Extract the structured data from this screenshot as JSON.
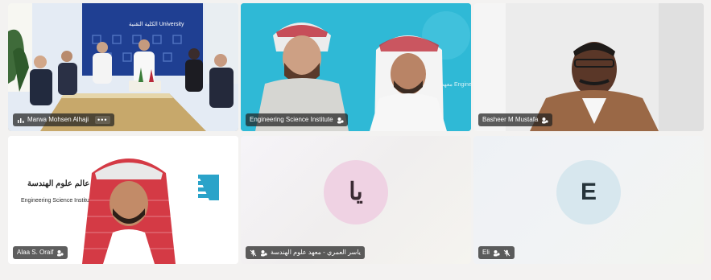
{
  "tiles": [
    {
      "name": "Marwa Mohsen Alhaji",
      "kind": "video",
      "more_label": "•••",
      "sign_text": "الكلية التقنية  University"
    },
    {
      "name": "Engineering Science Institute",
      "kind": "video",
      "sign_text": "معهد التدريب  Engineering Training"
    },
    {
      "name": "Basheer M Mustafa",
      "kind": "video"
    },
    {
      "name": "Alaa S. Oraif",
      "kind": "video",
      "logo_text_ar": "بس عالم علوم الهندسة",
      "logo_text_en": "Engineering Science Institute for Training"
    },
    {
      "name": "ياسر العمري - معهد علوم الهندسة",
      "kind": "avatar",
      "initial": "يا"
    },
    {
      "name": "Eli",
      "kind": "avatar",
      "initial": "E"
    }
  ],
  "icons": {
    "audio_bars": "audio-bars-icon",
    "participant": "participant-icon",
    "muted_mic": "mic-muted-icon"
  },
  "colors": {
    "page_bg": "#f3f2f1",
    "tag_bg": "#202020",
    "avatar_yasser": "#efd2e3",
    "avatar_eli": "#d7e7ee"
  }
}
